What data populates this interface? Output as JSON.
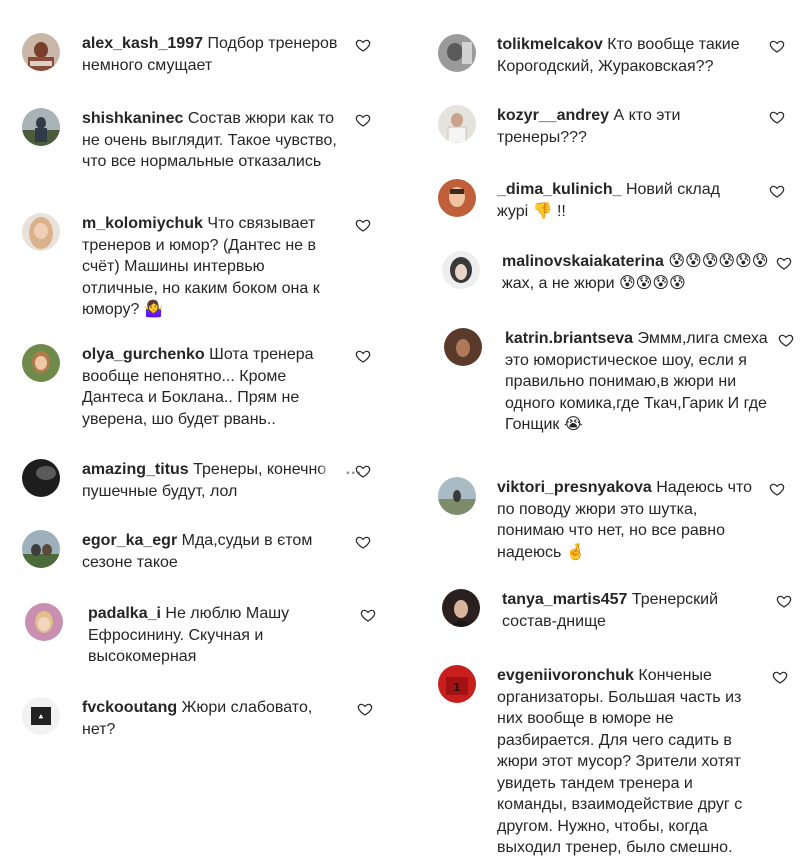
{
  "left_comments": [
    {
      "username": "alex_kash_1997",
      "text": "Подбор тренеров немного смущает"
    },
    {
      "username": "shishkaninec",
      "text": "Состав жюри как то не очень выглядит. Такое чувство, что все нормальные отказались"
    },
    {
      "username": "m_kolomiychuk",
      "text": "Что связывает тренеров и юмор? (Дантес не в счёт) Машины интервью отличные, но каким боком она к юмору? 🤷‍♀️"
    },
    {
      "username": "olya_gurchenko",
      "text": "Шота тренера вообще непонятно... Кроме Дантеса и Боклана.. Прям не уверена, шо будет рвань.."
    },
    {
      "username": "amazing_titus",
      "text": "Тренеры, конечно пушечные будут, лол",
      "more_label": "..."
    },
    {
      "username": "egor_ka_egr",
      "text": "Мда,судьи в єтом сезоне такое"
    },
    {
      "username": "padalka_i",
      "text": "Не люблю Машу Ефросинину. Скучная и высокомерная"
    },
    {
      "username": "fvckooutang",
      "text": "Жюри слабовато, нет?"
    }
  ],
  "right_comments": [
    {
      "username": "tolikmelcakov",
      "text": "Кто вообще такие Корогодский, Жураковская??"
    },
    {
      "username": "kozyr__andrey",
      "text": "А кто эти тренеры???"
    },
    {
      "username": "_dima_kulinich_",
      "text": "Новий склад журі 👎 !!"
    },
    {
      "username": "malinovskaiakaterina",
      "text": "😰😰😰😰😰😰жах, а не жюри 😰😰😰😰"
    },
    {
      "username": "katrin.briantseva",
      "text": "Эммм,лига смеха это юмористическое шоу, если я правильно понимаю,в жюри ни одного комика,где Ткач,Гарик И где Гонщик 😭"
    },
    {
      "username": "viktori_presnyakova",
      "text": "Надеюсь что по поводу жюри это шутка, понимаю что нет, но все равно надеюсь 🤞"
    },
    {
      "username": "tanya_martis457",
      "text": "Тренерский состав-днище"
    },
    {
      "username": "evgeniivoronchuk",
      "text": "Конченые организаторы. Большая часть из них вообще в юморе не разбирается. Для чего садить в жюри этот мусор? Зрители хотят увидеть тандем тренера и команды, взаимодействие друг с другом. Нужно, чтобы, когда выходил тренер, было смешно."
    }
  ],
  "avatars": {
    "left": [
      "#8a4a3a",
      "#2f3b46",
      "#d9b28c",
      "#b07a4a",
      "#1d1d1d",
      "#4d6b3a",
      "#c88fb0",
      "#222222"
    ],
    "right": [
      "#6b6b6b",
      "#c9c3b8",
      "#c0603a",
      "#3a3a3a",
      "#7a4a36",
      "#7d8c6a",
      "#2a2020",
      "#c81e1e"
    ]
  },
  "heart_icon": "heart-outline-icon"
}
